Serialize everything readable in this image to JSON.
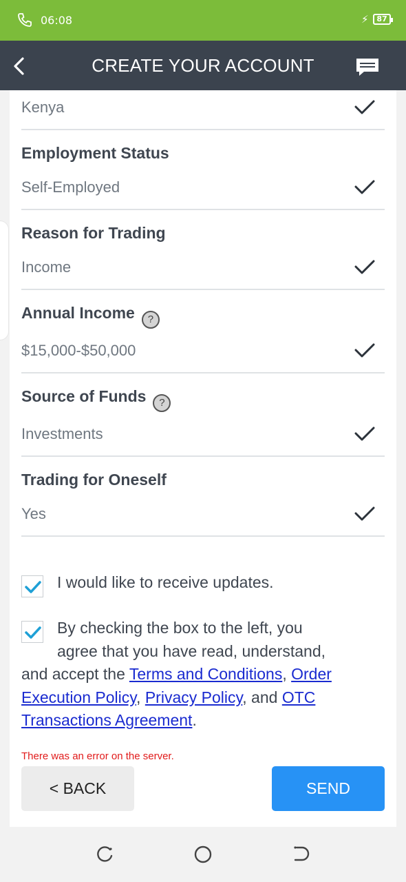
{
  "status_bar": {
    "time": "06:08",
    "battery": "87"
  },
  "header": {
    "title": "CREATE YOUR ACCOUNT"
  },
  "fields": [
    {
      "label": "",
      "value": "Kenya"
    },
    {
      "label": "Employment Status",
      "value": "Self-Employed"
    },
    {
      "label": "Reason for Trading",
      "value": "Income"
    },
    {
      "label": "Annual Income",
      "value": "$15,000-$50,000",
      "help": "?"
    },
    {
      "label": "Source of Funds",
      "value": "Investments",
      "help": "?"
    },
    {
      "label": "Trading for Oneself",
      "value": "Yes"
    }
  ],
  "consents": {
    "updates": {
      "checked": true,
      "text": "I would like to receive updates."
    },
    "agreement": {
      "checked": true,
      "text_1": "By checking the box to the left, you",
      "text_2": "agree that you have read, understand,",
      "text_3": "and accept the ",
      "link_terms": "Terms and Conditions",
      "sep_1": ", ",
      "link_order_1": "Order",
      "link_order_2": "Execution Policy",
      "sep_2": ", ",
      "link_privacy": "Privacy Policy",
      "sep_3": ", and ",
      "link_otc_1": "OTC",
      "link_otc_2": "Transactions Agreement",
      "end": "."
    }
  },
  "error_message": "There was an error on the server.",
  "buttons": {
    "back": "< BACK",
    "send": "SEND"
  },
  "colors": {
    "status_bar": "#7cbc3a",
    "app_bar": "#3b434e",
    "send": "#2792f5",
    "check": "#1ea0d6",
    "error": "#e11b1b",
    "link": "#1a2bd0"
  }
}
